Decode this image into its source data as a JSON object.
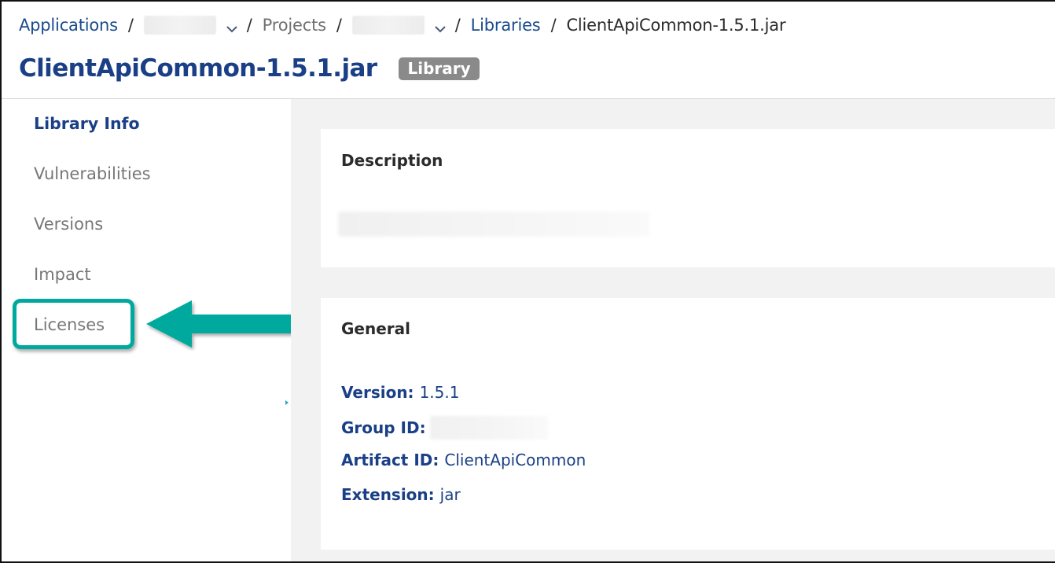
{
  "breadcrumb": {
    "applications": "Applications",
    "separator": "/",
    "projects": "Projects",
    "libraries": "Libraries",
    "current": "ClientApiCommon-1.5.1.jar"
  },
  "page": {
    "title": "ClientApiCommon-1.5.1.jar",
    "badge": "Library"
  },
  "sidebar": {
    "items": [
      {
        "label": "Library Info",
        "active": true
      },
      {
        "label": "Vulnerabilities",
        "active": false
      },
      {
        "label": "Versions",
        "active": false
      },
      {
        "label": "Impact",
        "active": false
      },
      {
        "label": "Licenses",
        "active": false,
        "highlighted": true
      }
    ]
  },
  "description": {
    "heading": "Description"
  },
  "general": {
    "heading": "General",
    "version_label": "Version:",
    "version_value": "1.5.1",
    "group_label": "Group ID:",
    "artifact_label": "Artifact ID:",
    "artifact_value": "ClientApiCommon",
    "extension_label": "Extension:",
    "extension_value": "jar"
  },
  "colors": {
    "primary": "#1a3f86",
    "link": "#1a4b8c",
    "badge_bg": "#8a8a8a",
    "annotation": "#00a99d",
    "content_bg": "#f2f2f2"
  },
  "icons": {
    "dropdown": "chevron-down-icon",
    "annotation_arrow": "arrow-left-icon"
  }
}
